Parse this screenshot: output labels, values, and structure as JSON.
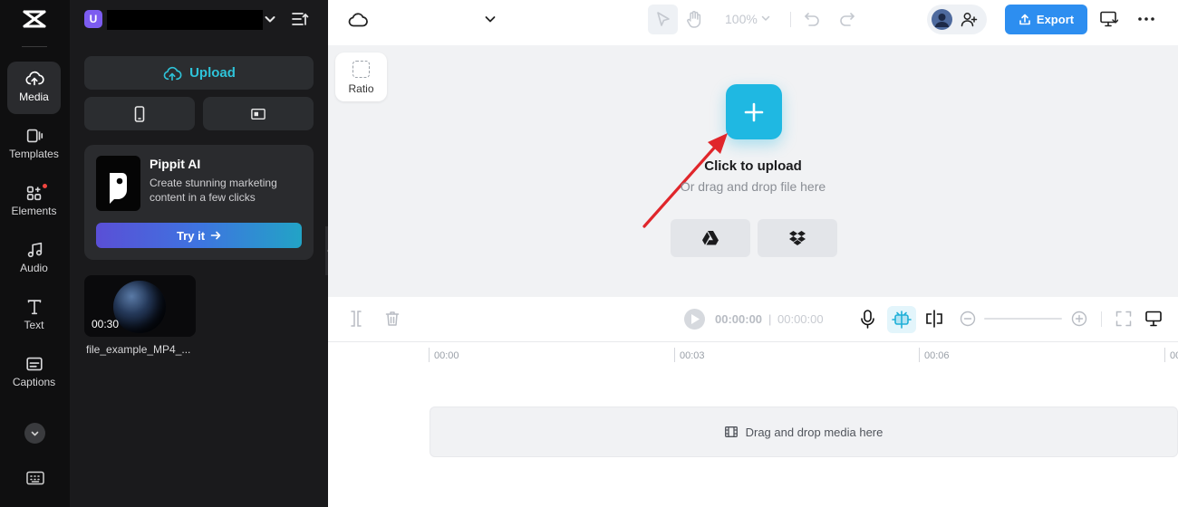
{
  "sidebar": {
    "items": [
      {
        "label": "Media",
        "icon": "media-cloud-icon",
        "active": true
      },
      {
        "label": "Templates",
        "icon": "templates-icon",
        "active": false
      },
      {
        "label": "Elements",
        "icon": "elements-icon",
        "active": false,
        "badge_dot": true
      },
      {
        "label": "Audio",
        "icon": "music-note-icon",
        "active": false
      },
      {
        "label": "Text",
        "icon": "text-t-icon",
        "active": false
      },
      {
        "label": "Captions",
        "icon": "captions-icon",
        "active": false
      }
    ]
  },
  "panel": {
    "project_initial": "U",
    "upload_label": "Upload",
    "promo": {
      "title": "Pippit AI",
      "description": "Create stunning marketing content in a few clicks",
      "button_label": "Try it"
    },
    "media": [
      {
        "name": "file_example_MP4_...",
        "duration": "00:30"
      }
    ]
  },
  "topbar": {
    "zoom": "100%",
    "export_label": "Export"
  },
  "canvas": {
    "ratio_label": "Ratio",
    "upload_title": "Click to upload",
    "upload_subtitle": "Or drag and drop file here",
    "sources": [
      "google-drive-icon",
      "dropbox-icon"
    ]
  },
  "timeline": {
    "current_time": "00:00:00",
    "separator": "|",
    "total_time": "00:00:00",
    "ruler_labels": [
      "00:00",
      "00:03",
      "00:06",
      "00"
    ],
    "drop_label": "Drag and drop media here"
  },
  "colors": {
    "accent": "#1fb8e2",
    "export": "#2d8ef0",
    "sidebar_bg": "#0f0f10",
    "panel_bg": "#1a1a1c",
    "annotation_arrow": "#e0262b"
  }
}
